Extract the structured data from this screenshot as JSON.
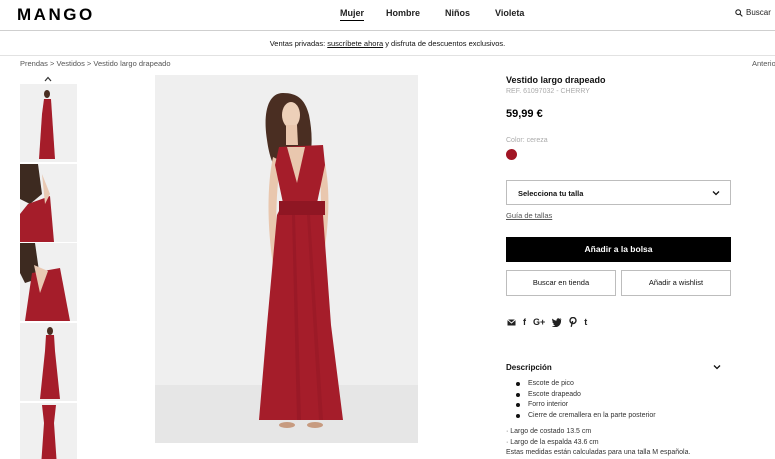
{
  "header": {
    "logo": "MANGO",
    "nav": [
      "Mujer",
      "Hombre",
      "Niños",
      "Violeta"
    ],
    "search_label": "Buscar"
  },
  "promo": {
    "prefix": "Ventas privadas: ",
    "link": "suscríbete ahora",
    "suffix": " y disfruta de descuentos exclusivos."
  },
  "breadcrumb": "Prendas > Vestidos > Vestido largo drapeado",
  "anterior": "Anterior",
  "product": {
    "title": "Vestido largo drapeado",
    "ref": "REF. 61097032 - CHERRY",
    "price": "59,99 €",
    "color_label": "Color: cereza",
    "swatch_color": "#a11524",
    "size_select": "Selecciona tu talla",
    "size_guide": "Guía de tallas",
    "add_to_bag": "Añadir a la bolsa",
    "find_in_store": "Buscar en tienda",
    "add_to_wishlist": "Añadir a wishlist"
  },
  "share_icons": [
    "email-icon",
    "facebook-icon",
    "google-plus-icon",
    "twitter-icon",
    "pinterest-icon",
    "tumblr-icon"
  ],
  "description": {
    "heading": "Descripción",
    "bullets": [
      "Escote de pico",
      "Escote drapeado",
      "Forro interior",
      "Cierre de cremallera en la parte posterior"
    ],
    "measures": [
      "· Largo de costado 13.5 cm",
      "· Largo de la espalda 43.6 cm",
      "Estas medidas están calculadas para una talla M española."
    ]
  }
}
